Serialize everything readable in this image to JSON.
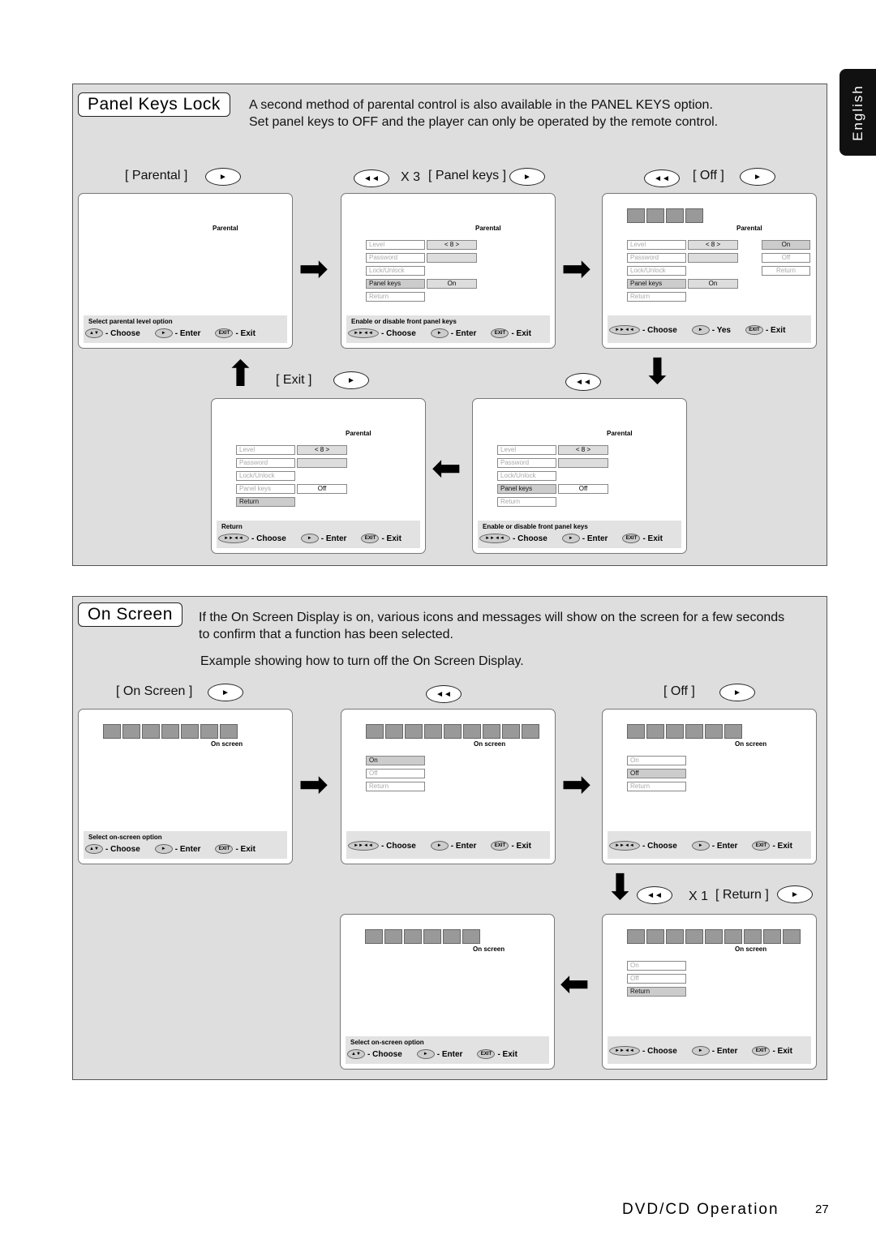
{
  "side_tab": "English",
  "panel_keys": {
    "title": "Panel Keys Lock",
    "desc1": "A second method of parental control is also available in the PANEL KEYS option.",
    "desc2": "Set panel keys to OFF and the player can only be operated by the remote control.",
    "captions": {
      "parental": "[ Parental ]",
      "x3": "X 3",
      "panel_keys": "[ Panel keys ]",
      "off": "[ Off ]",
      "exit": "[ Exit ]"
    }
  },
  "on_screen": {
    "title": "On Screen",
    "desc1": "If the On Screen Display is on, various icons and messages will show on the screen for a few seconds",
    "desc2": "to confirm that a function has been selected.",
    "desc3": "Example showing how to turn off the On Screen Display.",
    "captions": {
      "on_screen": "[ On Screen ]",
      "off": "[ Off ]",
      "x1": "X 1",
      "return": "[ Return ]"
    }
  },
  "screens": [
    {
      "title": "Parental",
      "rows": [],
      "values": [],
      "options": [],
      "hint": "Select parental level option",
      "footer": [
        {
          "icon": "up-down",
          "label": "- Choose"
        },
        {
          "icon": "play",
          "label": "- Enter"
        },
        {
          "icon": "exit",
          "label": "- Exit"
        }
      ],
      "icons": 0
    },
    {
      "title": "Parental",
      "rows": [
        {
          "label": "Level",
          "sel": false
        },
        {
          "label": "Password",
          "sel": false
        },
        {
          "label": "Lock/Unlock",
          "sel": false
        },
        {
          "label": "Panel keys",
          "sel": true
        },
        {
          "label": "Return",
          "sel": false
        }
      ],
      "values": [
        {
          "text": "< 8 >",
          "row": 0
        },
        {
          "text": "",
          "row": 1
        },
        {
          "text": "On",
          "row": 3
        }
      ],
      "options": [],
      "hint": "Enable or disable front panel keys",
      "footer": [
        {
          "icon": "ff-rew",
          "label": "- Choose"
        },
        {
          "icon": "play",
          "label": "- Enter"
        },
        {
          "icon": "exit",
          "label": "- Exit"
        }
      ],
      "icons": 0
    },
    {
      "title": "Parental",
      "rows": [
        {
          "label": "Level",
          "sel": false
        },
        {
          "label": "Password",
          "sel": false
        },
        {
          "label": "Lock/Unlock",
          "sel": false
        },
        {
          "label": "Panel keys",
          "sel": true
        },
        {
          "label": "Return",
          "sel": false
        }
      ],
      "values": [
        {
          "text": "< 8 >",
          "row": 0
        },
        {
          "text": "",
          "row": 1
        },
        {
          "text": "On",
          "row": 3
        }
      ],
      "options": [
        {
          "label": "On",
          "sel": true
        },
        {
          "label": "Off",
          "sel": false
        },
        {
          "label": "Return",
          "sel": false
        }
      ],
      "hint": "",
      "footer": [
        {
          "icon": "ff-rew",
          "label": "- Choose"
        },
        {
          "icon": "play",
          "label": "- Yes"
        },
        {
          "icon": "exit",
          "label": "- Exit"
        }
      ],
      "icons": 4
    },
    {
      "title": "Parental",
      "rows": [
        {
          "label": "Level",
          "sel": false
        },
        {
          "label": "Password",
          "sel": false
        },
        {
          "label": "Lock/Unlock",
          "sel": false
        },
        {
          "label": "Panel keys",
          "sel": false
        },
        {
          "label": "Return",
          "sel": true
        }
      ],
      "values": [
        {
          "text": "< 8 >",
          "row": 0
        },
        {
          "text": "",
          "row": 1
        },
        {
          "text": "Off",
          "row": 3,
          "white": true
        }
      ],
      "options": [],
      "hint": "Return",
      "footer": [
        {
          "icon": "ff-rew",
          "label": "- Choose"
        },
        {
          "icon": "play",
          "label": "- Enter"
        },
        {
          "icon": "exit",
          "label": "- Exit"
        }
      ],
      "icons": 0
    },
    {
      "title": "Parental",
      "rows": [
        {
          "label": "Level",
          "sel": false
        },
        {
          "label": "Password",
          "sel": false
        },
        {
          "label": "Lock/Unlock",
          "sel": false
        },
        {
          "label": "Panel keys",
          "sel": true
        },
        {
          "label": "Return",
          "sel": false
        }
      ],
      "values": [
        {
          "text": "< 8 >",
          "row": 0
        },
        {
          "text": "",
          "row": 1
        },
        {
          "text": "Off",
          "row": 3,
          "white": true
        }
      ],
      "options": [],
      "hint": "Enable or disable front panel keys",
      "footer": [
        {
          "icon": "ff-rew",
          "label": "- Choose"
        },
        {
          "icon": "play",
          "label": "- Enter"
        },
        {
          "icon": "exit",
          "label": "- Exit"
        }
      ],
      "icons": 0
    },
    {
      "title": "On screen",
      "rows": [],
      "values": [],
      "options": [],
      "hint": "Select on-screen option",
      "footer": [
        {
          "icon": "up-down",
          "label": "- Choose"
        },
        {
          "icon": "play",
          "label": "- Enter"
        },
        {
          "icon": "exit",
          "label": "- Exit"
        }
      ],
      "icons": 7
    },
    {
      "title": "On screen",
      "rows": [
        {
          "label": "On",
          "sel": true
        },
        {
          "label": "Off",
          "sel": false
        },
        {
          "label": "Return",
          "sel": false
        }
      ],
      "values": [],
      "options": [],
      "hint": "",
      "footer": [
        {
          "icon": "ff-rew",
          "label": "- Choose"
        },
        {
          "icon": "play",
          "label": "- Enter"
        },
        {
          "icon": "exit",
          "label": "- Exit"
        }
      ],
      "icons": 9
    },
    {
      "title": "On screen",
      "rows": [
        {
          "label": "On",
          "sel": false
        },
        {
          "label": "Off",
          "sel": true
        },
        {
          "label": "Return",
          "sel": false
        }
      ],
      "values": [],
      "options": [],
      "hint": "",
      "footer": [
        {
          "icon": "ff-rew",
          "label": "- Choose"
        },
        {
          "icon": "play",
          "label": "- Enter"
        },
        {
          "icon": "exit",
          "label": "- Exit"
        }
      ],
      "icons": 6
    },
    {
      "title": "On screen",
      "rows": [],
      "values": [],
      "options": [],
      "hint": "Select on-screen option",
      "footer": [
        {
          "icon": "up-down",
          "label": "- Choose"
        },
        {
          "icon": "play",
          "label": "- Enter"
        },
        {
          "icon": "exit",
          "label": "- Exit"
        }
      ],
      "icons": 6
    },
    {
      "title": "On screen",
      "rows": [
        {
          "label": "On",
          "sel": false
        },
        {
          "label": "Off",
          "sel": false
        },
        {
          "label": "Return",
          "sel": true
        }
      ],
      "values": [],
      "options": [],
      "hint": "",
      "footer": [
        {
          "icon": "ff-rew",
          "label": "- Choose"
        },
        {
          "icon": "play",
          "label": "- Enter"
        },
        {
          "icon": "exit",
          "label": "- Exit"
        }
      ],
      "icons": 9
    }
  ],
  "footer": {
    "section": "DVD/CD Operation",
    "page": "27"
  }
}
